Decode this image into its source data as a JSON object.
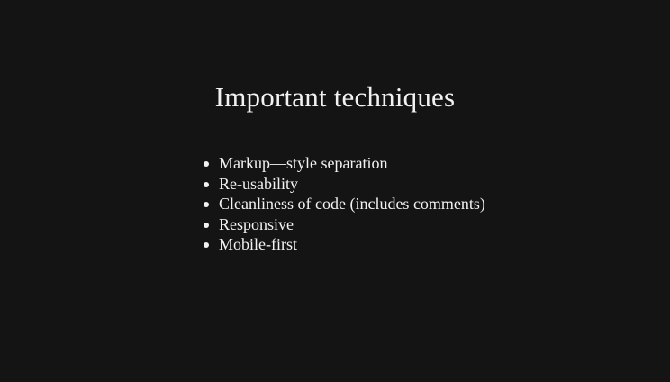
{
  "slide": {
    "title": "Important techniques",
    "bullets": [
      "Markup—style separation",
      "Re-usability",
      "Cleanliness of code (includes comments)",
      "Responsive",
      "Mobile-first"
    ]
  },
  "colors": {
    "background": "#141414",
    "text": "#f2f2f2"
  }
}
